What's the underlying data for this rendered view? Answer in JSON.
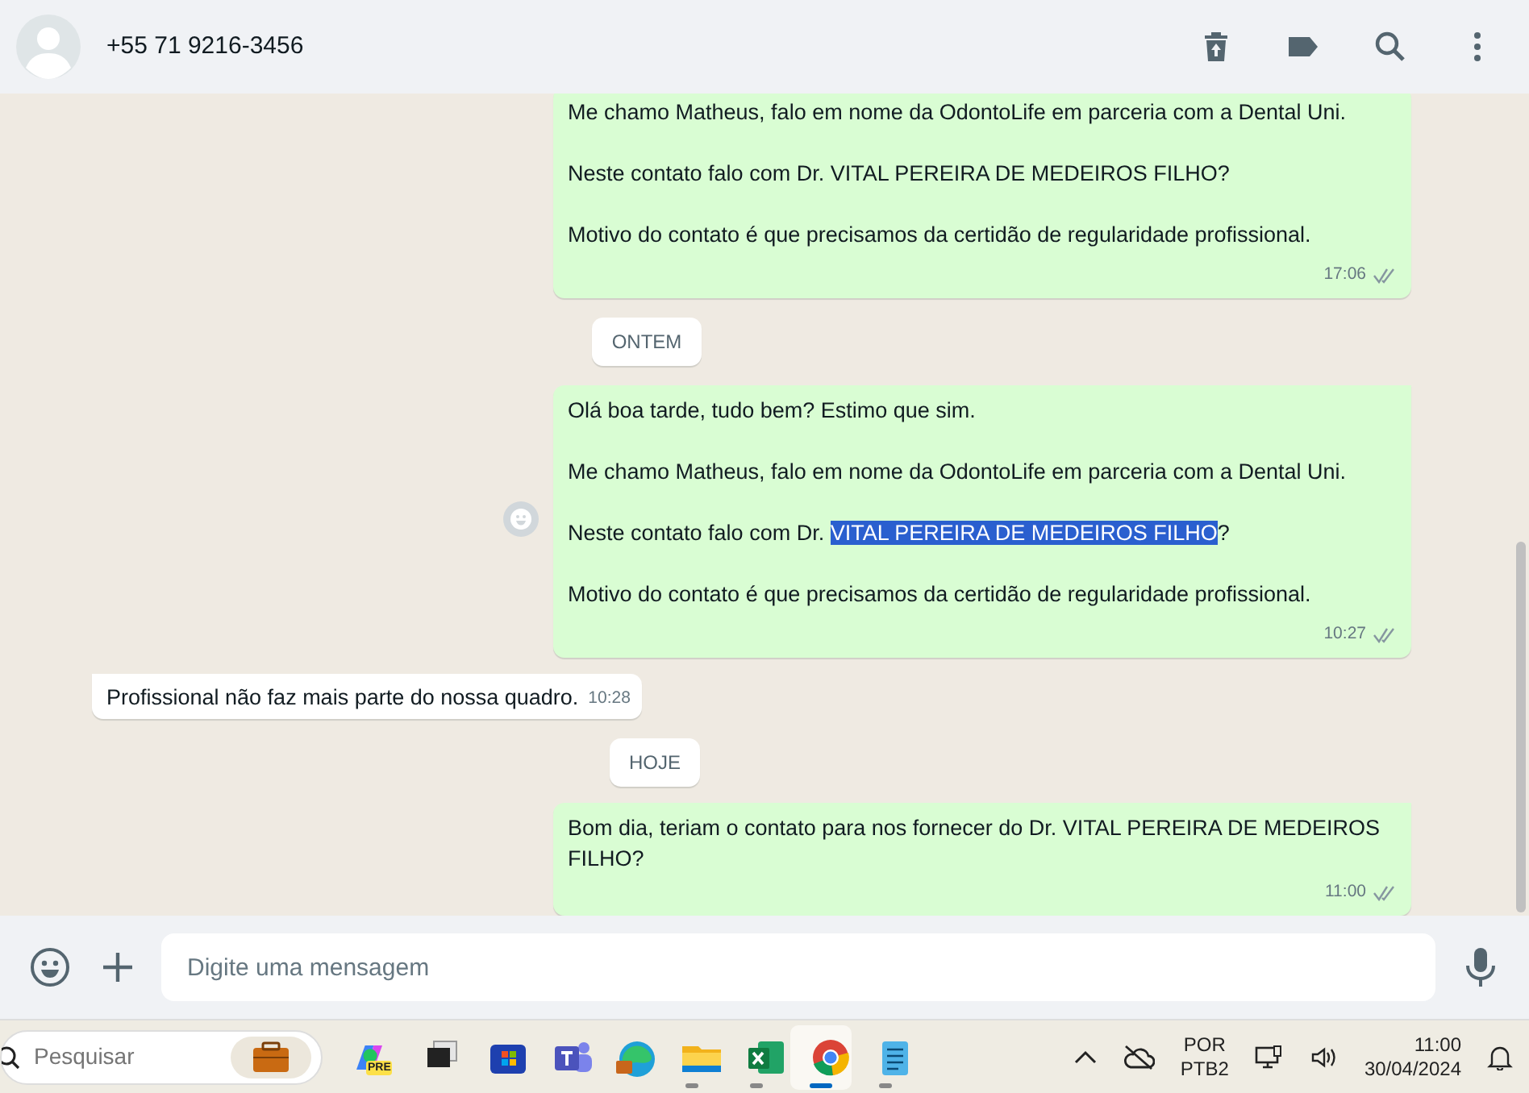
{
  "header": {
    "contact": "+55 71 9216-3456"
  },
  "messages": [
    {
      "kind": "outgoing",
      "paragraphs": [
        [
          {
            "text": "Me chamo Matheus, falo em nome da OdontoLife em parceria com a Dental Uni.",
            "selected": false
          }
        ],
        [
          {
            "text": "Neste contato falo com Dr. VITAL PEREIRA DE MEDEIROS FILHO?",
            "selected": false
          }
        ],
        [
          {
            "text": "Motivo do contato é que precisamos da certidão de regularidade profissional.",
            "selected": false
          }
        ]
      ],
      "time": "17:06",
      "read": true,
      "tail": false,
      "reaction_button": false
    },
    {
      "kind": "date",
      "text": "ONTEM"
    },
    {
      "kind": "outgoing",
      "paragraphs": [
        [
          {
            "text": "Olá boa tarde, tudo bem? Estimo que sim.",
            "selected": false
          }
        ],
        [
          {
            "text": "Me chamo Matheus, falo em nome da OdontoLife em parceria com a Dental Uni.",
            "selected": false
          }
        ],
        [
          {
            "text": "Neste contato falo com Dr. ",
            "selected": false
          },
          {
            "text": "VITAL PEREIRA DE MEDEIROS FILHO",
            "selected": true
          },
          {
            "text": "?",
            "selected": false
          }
        ],
        [
          {
            "text": "Motivo do contato é que precisamos da certidão de regularidade profissional.",
            "selected": false
          }
        ]
      ],
      "time": "10:27",
      "read": true,
      "tail": true,
      "reaction_button": true
    },
    {
      "kind": "incoming",
      "paragraphs": [
        [
          {
            "text": "Profissional não faz mais parte do nossa quadro.",
            "selected": false
          }
        ]
      ],
      "time": "10:28",
      "tail": true,
      "reaction_button": false
    },
    {
      "kind": "date",
      "text": "HOJE"
    },
    {
      "kind": "outgoing",
      "paragraphs": [
        [
          {
            "text": "Bom dia, teriam o contato para nos fornecer do Dr. VITAL PEREIRA DE MEDEIROS FILHO?",
            "selected": false
          }
        ]
      ],
      "time": "11:00",
      "read": true,
      "tail": true,
      "reaction_button": false
    }
  ],
  "composer": {
    "placeholder": "Digite uma mensagem"
  },
  "taskbar": {
    "search_placeholder": "Pesquisar",
    "apps": [
      {
        "kind": "copilot",
        "badge": "PRE",
        "running": false,
        "active": false
      },
      {
        "kind": "window",
        "running": false,
        "active": false
      },
      {
        "kind": "store",
        "running": false,
        "active": false
      },
      {
        "kind": "teams",
        "running": false,
        "active": false
      },
      {
        "kind": "edge",
        "running": false,
        "active": false
      },
      {
        "kind": "folder",
        "running": true,
        "active": false
      },
      {
        "kind": "excel",
        "running": true,
        "active": false
      },
      {
        "kind": "chrome",
        "running": true,
        "active": true
      },
      {
        "kind": "notepad",
        "running": true,
        "active": false
      }
    ],
    "language": "POR",
    "layout": "PTB2",
    "time": "11:00",
    "date": "30/04/2024"
  }
}
